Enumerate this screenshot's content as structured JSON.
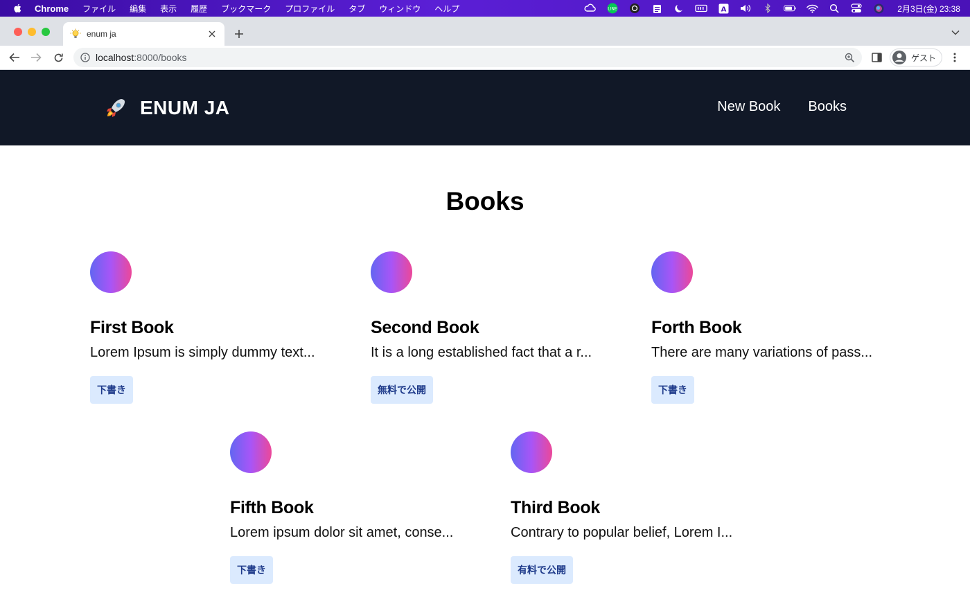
{
  "menubar": {
    "app_name": "Chrome",
    "items": [
      "ファイル",
      "編集",
      "表示",
      "履歴",
      "ブックマーク",
      "プロファイル",
      "タブ",
      "ウィンドウ",
      "ヘルプ"
    ],
    "clock": "2月3日(金)  23:38"
  },
  "browser": {
    "tab_title": "enum ja",
    "url_host": "localhost",
    "url_path": ":8000/books",
    "profile_name": "ゲスト"
  },
  "header": {
    "brand": "ENUM JA",
    "nav": [
      "New Book",
      "Books"
    ]
  },
  "main": {
    "title": "Books",
    "books": [
      {
        "title": "First Book",
        "description": "Lorem Ipsum is simply dummy text...",
        "status": "下書き"
      },
      {
        "title": "Second Book",
        "description": "It is a long established fact that a r...",
        "status": "無料で公開"
      },
      {
        "title": "Forth Book",
        "description": "There are many variations of pass...",
        "status": "下書き"
      },
      {
        "title": "Fifth Book",
        "description": "Lorem ipsum dolor sit amet, conse...",
        "status": "下書き"
      },
      {
        "title": "Third Book",
        "description": "Contrary to popular belief, Lorem I...",
        "status": "有料で公開"
      }
    ]
  },
  "colors": {
    "header_bg": "#111827",
    "badge_bg": "#dbeafe",
    "badge_text": "#1e3a8a",
    "cover_gradient": [
      "#6366f1",
      "#a855f7",
      "#ec4899"
    ]
  }
}
